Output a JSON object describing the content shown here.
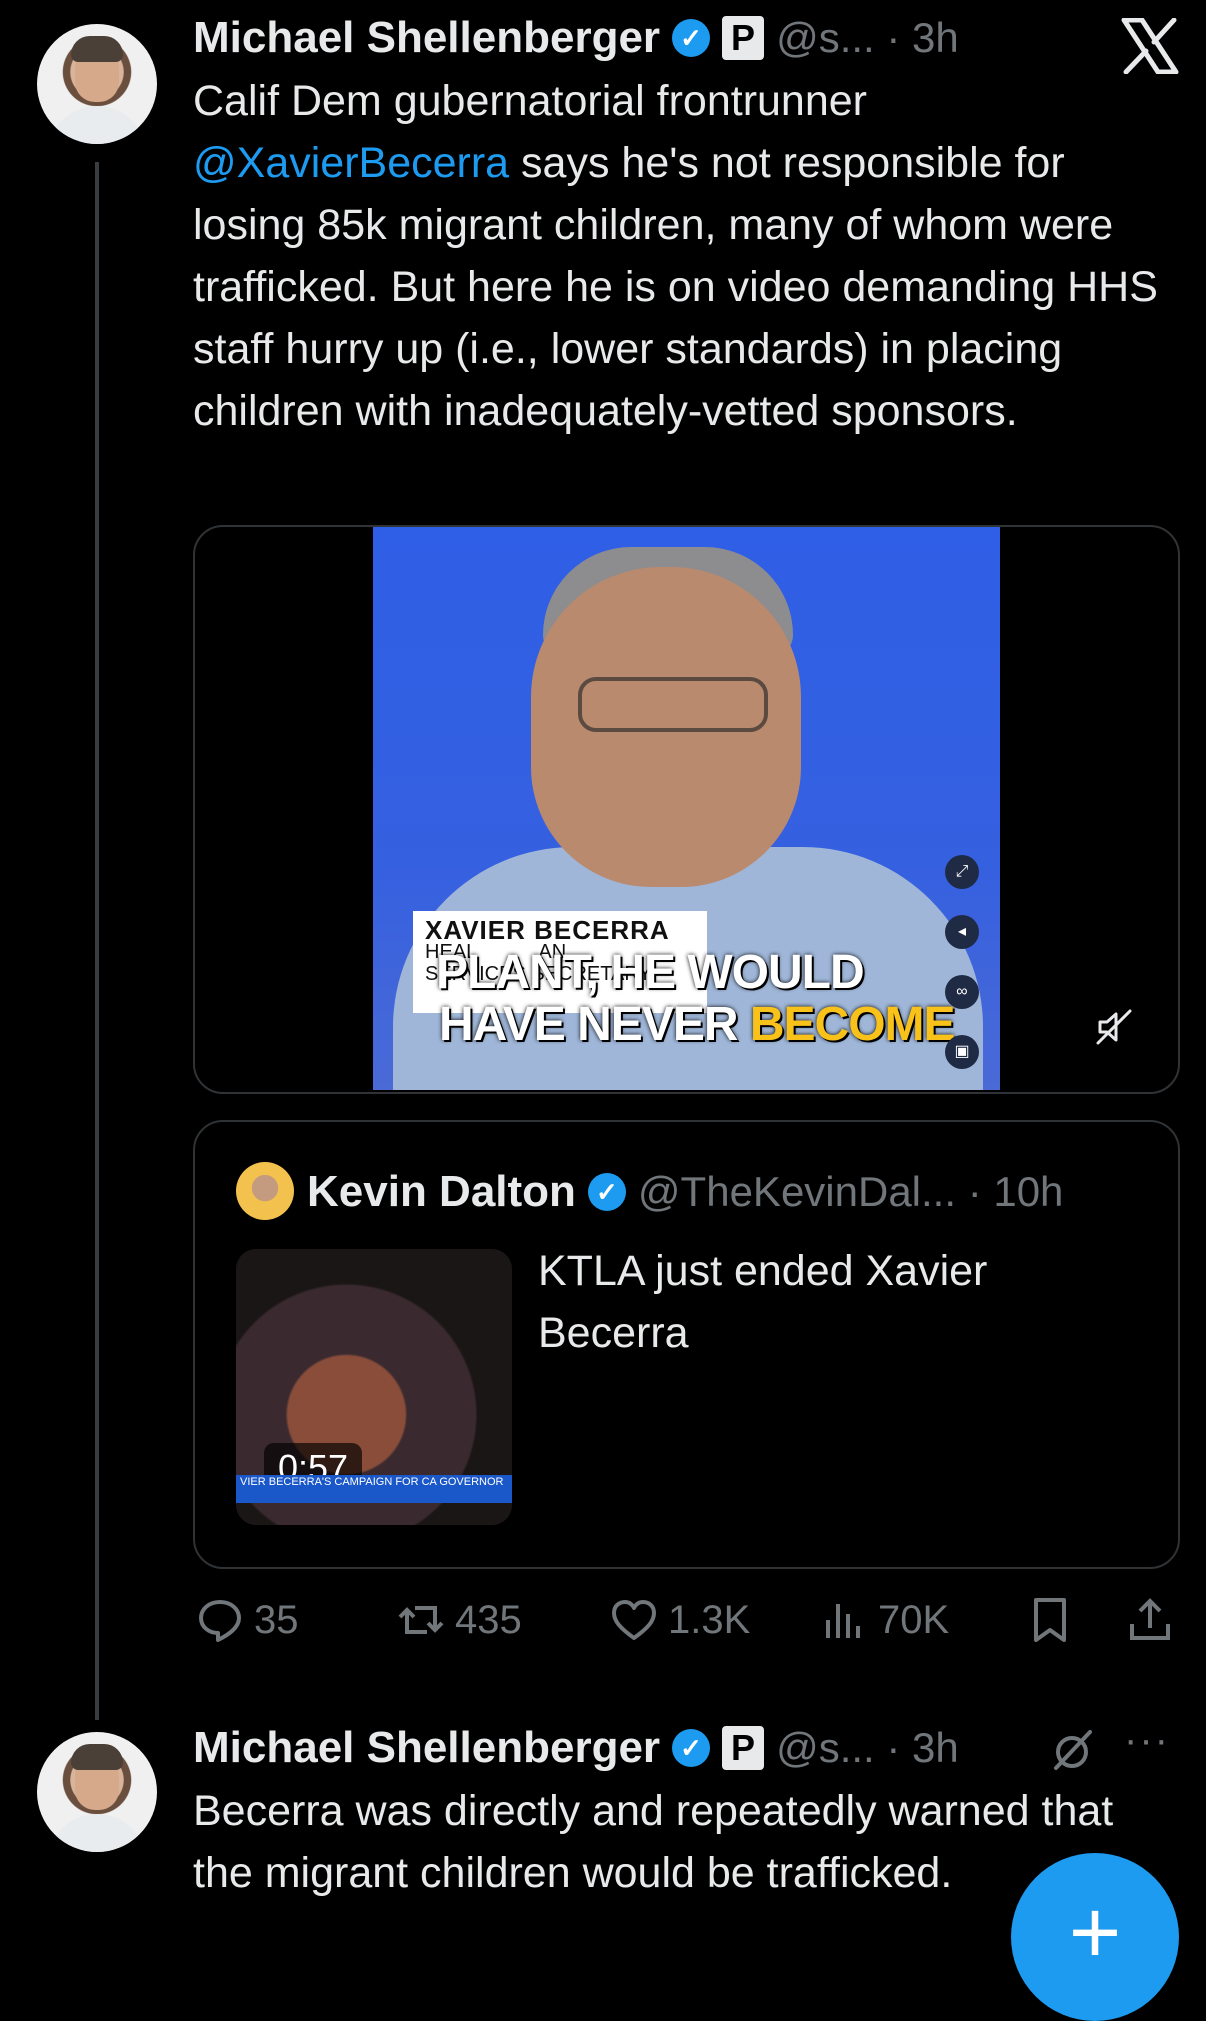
{
  "close_icon": "x-icon",
  "tweet1": {
    "author_name": "Michael Shellenberger",
    "badge_letter": "P",
    "handle_time": "@s... · 3h",
    "text_part1": "Calif Dem gubernatorial frontrunner ",
    "mention": "@XavierBecerra",
    "text_part2": " says he's not responsible for losing 85k migrant children, many of whom were trafficked. But here he is on video demanding HHS staff hurry up (i.e., lower standards) in placing children with inadequately-vetted sponsors.",
    "video": {
      "lower_third_name": "XAVIER BECERRA",
      "lower_third_line1": "HEAL",
      "lower_third_line1b": "AN",
      "lower_third_line2": "SERVICES SECRETARY",
      "caption_line1": "PLANT, HE WOULD",
      "caption_line2_white": "HAVE NEVER ",
      "caption_line2_yellow": "BECOME"
    },
    "quote": {
      "author_name": "Kevin Dalton",
      "handle_time": "@TheKevinDal... · 10h",
      "text": "KTLA just ended Xavier Becerra",
      "duration": "0:57",
      "ticker_text": "VIER BECERRA'S CAMPAIGN FOR CA GOVERNOR"
    },
    "actions": {
      "replies": "35",
      "reposts": "435",
      "likes": "1.3K",
      "views": "70K"
    }
  },
  "tweet2": {
    "author_name": "Michael Shellenberger",
    "badge_letter": "P",
    "handle_time": "@s... · 3h",
    "text": "Becerra was directly and repeatedly warned that the migrant children would be trafficked."
  },
  "fab_label": "+"
}
